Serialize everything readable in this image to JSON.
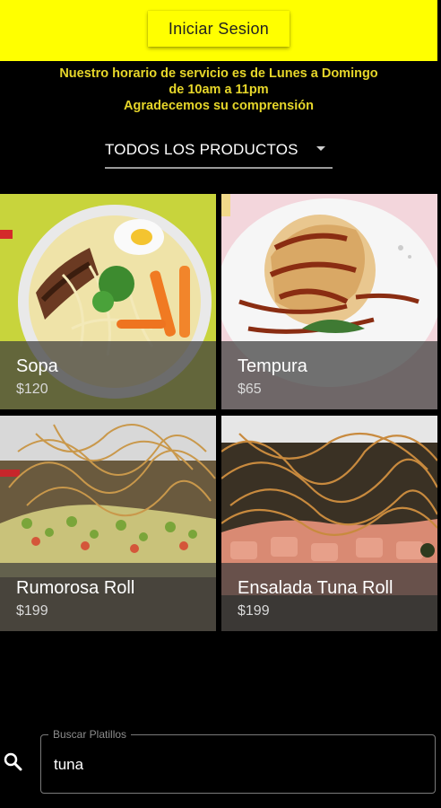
{
  "header": {
    "login_label": "Iniciar Sesion",
    "background_color": "#ffff00"
  },
  "notice": {
    "line1": "Nuestro horario de servicio es de Lunes a Domingo",
    "line2": "de 10am a 11pm",
    "line3": "Agradecemos su comprensión",
    "color": "#e6d62a"
  },
  "category_select": {
    "selected": "TODOS LOS PRODUCTOS"
  },
  "products": [
    {
      "name": "Sopa",
      "price": "$120"
    },
    {
      "name": "Tempura",
      "price": "$65"
    },
    {
      "name": "Rumorosa Roll",
      "price": "$199"
    },
    {
      "name": "Ensalada Tuna Roll",
      "price": "$199"
    }
  ],
  "search": {
    "label": "Buscar Platillos",
    "value": "tuna",
    "icon": "search-icon"
  }
}
